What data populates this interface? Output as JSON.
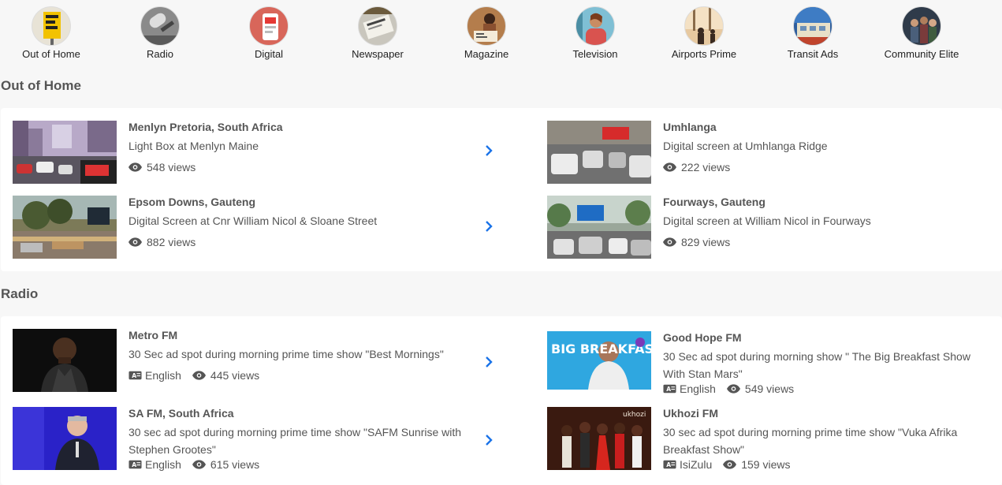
{
  "categories": [
    {
      "label": "Out of Home",
      "icon": "billboard-thumb-icon"
    },
    {
      "label": "Radio",
      "icon": "microphone-thumb-icon"
    },
    {
      "label": "Digital",
      "icon": "phone-thumb-icon"
    },
    {
      "label": "Newspaper",
      "icon": "newspaper-thumb-icon"
    },
    {
      "label": "Magazine",
      "icon": "magazine-thumb-icon"
    },
    {
      "label": "Television",
      "icon": "television-thumb-icon"
    },
    {
      "label": "Airports Prime",
      "icon": "airport-thumb-icon"
    },
    {
      "label": "Transit Ads",
      "icon": "bus-thumb-icon"
    },
    {
      "label": "Community Elite",
      "icon": "community-thumb-icon"
    }
  ],
  "sections": {
    "ooh": {
      "title": "Out of Home",
      "items": [
        {
          "title": "Menlyn Pretoria, South Africa",
          "desc": "Light Box at Menlyn Maine",
          "views": "548 views"
        },
        {
          "title": "Umhlanga",
          "desc": "Digital screen at Umhlanga Ridge",
          "views": "222 views"
        },
        {
          "title": "Epsom Downs, Gauteng",
          "desc": "Digital Screen at Cnr William Nicol & Sloane Street",
          "views": "882 views"
        },
        {
          "title": "Fourways, Gauteng",
          "desc": "Digital screen at William Nicol in Fourways",
          "views": "829 views"
        }
      ]
    },
    "radio": {
      "title": "Radio",
      "items": [
        {
          "title": "Metro FM",
          "desc": "30 Sec ad spot during morning prime time show \"Best Mornings\"",
          "lang": "English",
          "views": "445 views"
        },
        {
          "title": "Good Hope FM",
          "desc": "30 Sec ad spot during morning show \" The Big Breakfast Show With Stan Mars\"",
          "lang": "English",
          "views": "549 views",
          "thumb_text": "BIG BREAKFAST"
        },
        {
          "title": "SA FM, South Africa",
          "desc": "30 sec ad spot during morning prime time show \"SAFM Sunrise with Stephen Grootes\"",
          "lang": "English",
          "views": "615 views"
        },
        {
          "title": "Ukhozi FM",
          "desc": "30 sec ad spot during morning prime time show \"Vuka Afrika Breakfast Show\"",
          "lang": "IsiZulu",
          "views": "159 views",
          "thumb_text": "ukhozi"
        }
      ]
    }
  },
  "colors": {
    "accent": "#1a73e8",
    "panel": "#ffffff",
    "bg": "#f7f7f7"
  }
}
